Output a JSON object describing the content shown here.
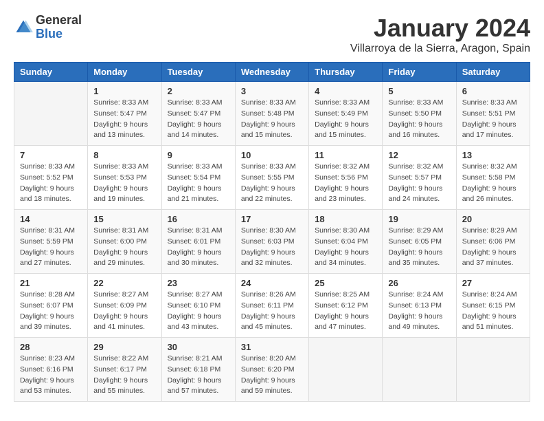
{
  "header": {
    "logo_general": "General",
    "logo_blue": "Blue",
    "month_title": "January 2024",
    "location": "Villarroya de la Sierra, Aragon, Spain"
  },
  "days_of_week": [
    "Sunday",
    "Monday",
    "Tuesday",
    "Wednesday",
    "Thursday",
    "Friday",
    "Saturday"
  ],
  "weeks": [
    [
      {
        "day": "",
        "sunrise": "",
        "sunset": "",
        "daylight": ""
      },
      {
        "day": "1",
        "sunrise": "Sunrise: 8:33 AM",
        "sunset": "Sunset: 5:47 PM",
        "daylight": "Daylight: 9 hours and 13 minutes."
      },
      {
        "day": "2",
        "sunrise": "Sunrise: 8:33 AM",
        "sunset": "Sunset: 5:47 PM",
        "daylight": "Daylight: 9 hours and 14 minutes."
      },
      {
        "day": "3",
        "sunrise": "Sunrise: 8:33 AM",
        "sunset": "Sunset: 5:48 PM",
        "daylight": "Daylight: 9 hours and 15 minutes."
      },
      {
        "day": "4",
        "sunrise": "Sunrise: 8:33 AM",
        "sunset": "Sunset: 5:49 PM",
        "daylight": "Daylight: 9 hours and 15 minutes."
      },
      {
        "day": "5",
        "sunrise": "Sunrise: 8:33 AM",
        "sunset": "Sunset: 5:50 PM",
        "daylight": "Daylight: 9 hours and 16 minutes."
      },
      {
        "day": "6",
        "sunrise": "Sunrise: 8:33 AM",
        "sunset": "Sunset: 5:51 PM",
        "daylight": "Daylight: 9 hours and 17 minutes."
      }
    ],
    [
      {
        "day": "7",
        "sunrise": "Sunrise: 8:33 AM",
        "sunset": "Sunset: 5:52 PM",
        "daylight": "Daylight: 9 hours and 18 minutes."
      },
      {
        "day": "8",
        "sunrise": "Sunrise: 8:33 AM",
        "sunset": "Sunset: 5:53 PM",
        "daylight": "Daylight: 9 hours and 19 minutes."
      },
      {
        "day": "9",
        "sunrise": "Sunrise: 8:33 AM",
        "sunset": "Sunset: 5:54 PM",
        "daylight": "Daylight: 9 hours and 21 minutes."
      },
      {
        "day": "10",
        "sunrise": "Sunrise: 8:33 AM",
        "sunset": "Sunset: 5:55 PM",
        "daylight": "Daylight: 9 hours and 22 minutes."
      },
      {
        "day": "11",
        "sunrise": "Sunrise: 8:32 AM",
        "sunset": "Sunset: 5:56 PM",
        "daylight": "Daylight: 9 hours and 23 minutes."
      },
      {
        "day": "12",
        "sunrise": "Sunrise: 8:32 AM",
        "sunset": "Sunset: 5:57 PM",
        "daylight": "Daylight: 9 hours and 24 minutes."
      },
      {
        "day": "13",
        "sunrise": "Sunrise: 8:32 AM",
        "sunset": "Sunset: 5:58 PM",
        "daylight": "Daylight: 9 hours and 26 minutes."
      }
    ],
    [
      {
        "day": "14",
        "sunrise": "Sunrise: 8:31 AM",
        "sunset": "Sunset: 5:59 PM",
        "daylight": "Daylight: 9 hours and 27 minutes."
      },
      {
        "day": "15",
        "sunrise": "Sunrise: 8:31 AM",
        "sunset": "Sunset: 6:00 PM",
        "daylight": "Daylight: 9 hours and 29 minutes."
      },
      {
        "day": "16",
        "sunrise": "Sunrise: 8:31 AM",
        "sunset": "Sunset: 6:01 PM",
        "daylight": "Daylight: 9 hours and 30 minutes."
      },
      {
        "day": "17",
        "sunrise": "Sunrise: 8:30 AM",
        "sunset": "Sunset: 6:03 PM",
        "daylight": "Daylight: 9 hours and 32 minutes."
      },
      {
        "day": "18",
        "sunrise": "Sunrise: 8:30 AM",
        "sunset": "Sunset: 6:04 PM",
        "daylight": "Daylight: 9 hours and 34 minutes."
      },
      {
        "day": "19",
        "sunrise": "Sunrise: 8:29 AM",
        "sunset": "Sunset: 6:05 PM",
        "daylight": "Daylight: 9 hours and 35 minutes."
      },
      {
        "day": "20",
        "sunrise": "Sunrise: 8:29 AM",
        "sunset": "Sunset: 6:06 PM",
        "daylight": "Daylight: 9 hours and 37 minutes."
      }
    ],
    [
      {
        "day": "21",
        "sunrise": "Sunrise: 8:28 AM",
        "sunset": "Sunset: 6:07 PM",
        "daylight": "Daylight: 9 hours and 39 minutes."
      },
      {
        "day": "22",
        "sunrise": "Sunrise: 8:27 AM",
        "sunset": "Sunset: 6:09 PM",
        "daylight": "Daylight: 9 hours and 41 minutes."
      },
      {
        "day": "23",
        "sunrise": "Sunrise: 8:27 AM",
        "sunset": "Sunset: 6:10 PM",
        "daylight": "Daylight: 9 hours and 43 minutes."
      },
      {
        "day": "24",
        "sunrise": "Sunrise: 8:26 AM",
        "sunset": "Sunset: 6:11 PM",
        "daylight": "Daylight: 9 hours and 45 minutes."
      },
      {
        "day": "25",
        "sunrise": "Sunrise: 8:25 AM",
        "sunset": "Sunset: 6:12 PM",
        "daylight": "Daylight: 9 hours and 47 minutes."
      },
      {
        "day": "26",
        "sunrise": "Sunrise: 8:24 AM",
        "sunset": "Sunset: 6:13 PM",
        "daylight": "Daylight: 9 hours and 49 minutes."
      },
      {
        "day": "27",
        "sunrise": "Sunrise: 8:24 AM",
        "sunset": "Sunset: 6:15 PM",
        "daylight": "Daylight: 9 hours and 51 minutes."
      }
    ],
    [
      {
        "day": "28",
        "sunrise": "Sunrise: 8:23 AM",
        "sunset": "Sunset: 6:16 PM",
        "daylight": "Daylight: 9 hours and 53 minutes."
      },
      {
        "day": "29",
        "sunrise": "Sunrise: 8:22 AM",
        "sunset": "Sunset: 6:17 PM",
        "daylight": "Daylight: 9 hours and 55 minutes."
      },
      {
        "day": "30",
        "sunrise": "Sunrise: 8:21 AM",
        "sunset": "Sunset: 6:18 PM",
        "daylight": "Daylight: 9 hours and 57 minutes."
      },
      {
        "day": "31",
        "sunrise": "Sunrise: 8:20 AM",
        "sunset": "Sunset: 6:20 PM",
        "daylight": "Daylight: 9 hours and 59 minutes."
      },
      {
        "day": "",
        "sunrise": "",
        "sunset": "",
        "daylight": ""
      },
      {
        "day": "",
        "sunrise": "",
        "sunset": "",
        "daylight": ""
      },
      {
        "day": "",
        "sunrise": "",
        "sunset": "",
        "daylight": ""
      }
    ]
  ]
}
